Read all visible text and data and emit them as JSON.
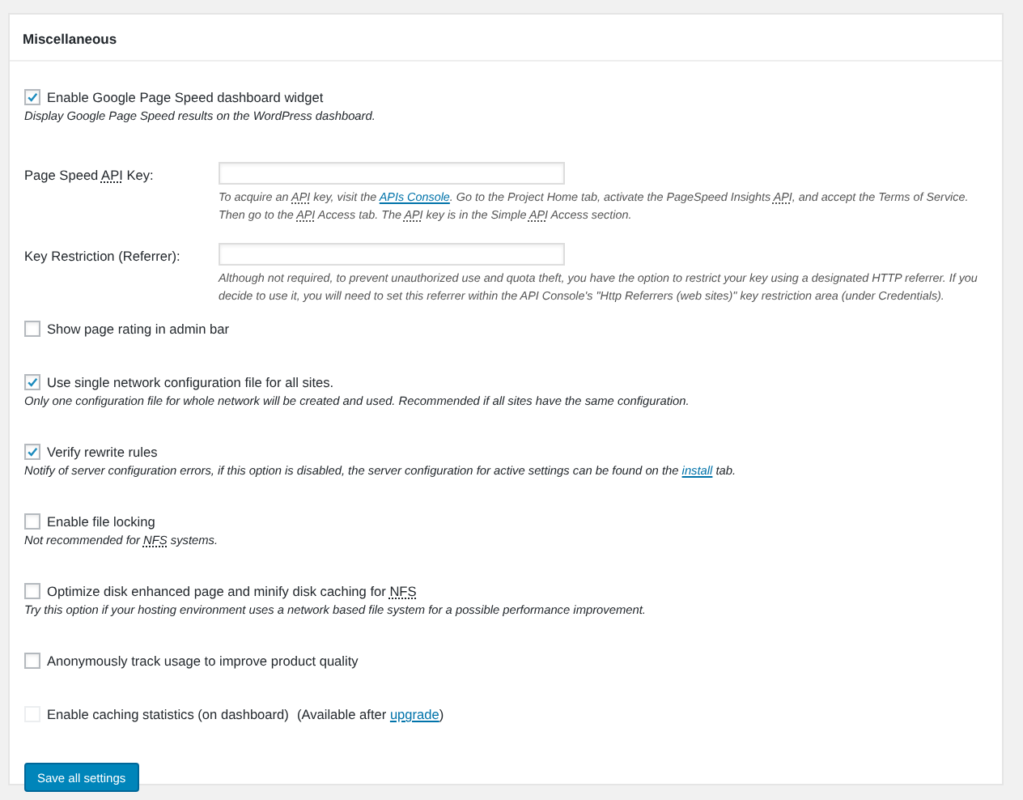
{
  "section": {
    "title": "Miscellaneous"
  },
  "settings": [
    {
      "kind": "checkbox",
      "checked": true,
      "disabled": false,
      "label": [
        {
          "kind": "text",
          "text": "Enable Google Page Speed dashboard widget"
        }
      ],
      "description": [
        {
          "kind": "text",
          "text": "Display Google Page Speed results on the WordPress dashboard."
        }
      ]
    },
    {
      "kind": "field",
      "label": [
        {
          "kind": "text",
          "text": "Page Speed "
        },
        {
          "kind": "abbr",
          "text": "API"
        },
        {
          "kind": "text",
          "text": " Key:"
        }
      ],
      "description": [
        {
          "kind": "text",
          "text": "To acquire an "
        },
        {
          "kind": "abbr",
          "text": "API"
        },
        {
          "kind": "text",
          "text": " key, visit the "
        },
        {
          "kind": "link",
          "text": "APIs Console"
        },
        {
          "kind": "text",
          "text": ". Go to the Project Home tab, activate the PageSpeed Insights "
        },
        {
          "kind": "abbr",
          "text": "API"
        },
        {
          "kind": "text",
          "text": ", and accept the Terms of Service. Then go to the "
        },
        {
          "kind": "abbr",
          "text": "API"
        },
        {
          "kind": "text",
          "text": " Access tab. The "
        },
        {
          "kind": "abbr",
          "text": "API"
        },
        {
          "kind": "text",
          "text": " key is in the Simple "
        },
        {
          "kind": "abbr",
          "text": "API"
        },
        {
          "kind": "text",
          "text": " Access section."
        }
      ]
    },
    {
      "kind": "field",
      "label": [
        {
          "kind": "text",
          "text": "Key Restriction (Referrer):"
        }
      ],
      "description": [
        {
          "kind": "text",
          "text": "Although not required, to prevent unauthorized use and quota theft, you have the option to restrict your key using a designated HTTP referrer. If you decide to use it, you will need to set this referrer within the API Console's \"Http Referrers (web sites)\" key restriction area (under Credentials)."
        }
      ]
    },
    {
      "kind": "checkbox",
      "checked": false,
      "disabled": false,
      "label": [
        {
          "kind": "text",
          "text": "Show page rating in admin bar"
        }
      ]
    },
    {
      "kind": "checkbox",
      "checked": true,
      "disabled": false,
      "label": [
        {
          "kind": "text",
          "text": "Use single network configuration file for all sites."
        }
      ],
      "description": [
        {
          "kind": "text",
          "text": "Only one configuration file for whole network will be created and used. Recommended if all sites have the same configuration."
        }
      ]
    },
    {
      "kind": "checkbox",
      "checked": true,
      "disabled": false,
      "label": [
        {
          "kind": "text",
          "text": "Verify rewrite rules"
        }
      ],
      "description": [
        {
          "kind": "text",
          "text": "Notify of server configuration errors, if this option is disabled, the server configuration for active settings can be found on the "
        },
        {
          "kind": "link",
          "text": "install"
        },
        {
          "kind": "text",
          "text": " tab."
        }
      ]
    },
    {
      "kind": "checkbox",
      "checked": false,
      "disabled": false,
      "label": [
        {
          "kind": "text",
          "text": "Enable file locking"
        }
      ],
      "description": [
        {
          "kind": "text",
          "text": "Not recommended for "
        },
        {
          "kind": "abbr",
          "text": "NFS"
        },
        {
          "kind": "text",
          "text": " systems."
        }
      ]
    },
    {
      "kind": "checkbox",
      "checked": false,
      "disabled": false,
      "label": [
        {
          "kind": "text",
          "text": "Optimize disk enhanced page and minify disk caching for "
        },
        {
          "kind": "abbr",
          "text": "NFS"
        }
      ],
      "description": [
        {
          "kind": "text",
          "text": "Try this option if your hosting environment uses a network based file system for a possible performance improvement."
        }
      ]
    },
    {
      "kind": "checkbox",
      "checked": false,
      "disabled": false,
      "label": [
        {
          "kind": "text",
          "text": "Anonymously track usage to improve product quality"
        }
      ]
    },
    {
      "kind": "checkbox",
      "checked": false,
      "disabled": true,
      "label": [
        {
          "kind": "text",
          "text": "Enable caching statistics (on dashboard)"
        }
      ],
      "note": [
        {
          "kind": "text",
          "text": "(Available after "
        },
        {
          "kind": "link",
          "text": "upgrade"
        },
        {
          "kind": "text",
          "text": ")"
        }
      ]
    }
  ],
  "save_button": "Save all settings"
}
